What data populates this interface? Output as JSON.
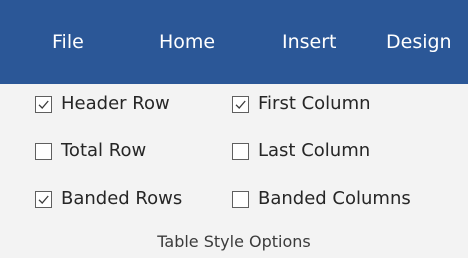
{
  "tabs": [
    "File",
    "Home",
    "Insert",
    "Design"
  ],
  "options": {
    "header_row": {
      "label": "Header Row",
      "checked": true
    },
    "total_row": {
      "label": "Total Row",
      "checked": false
    },
    "banded_rows": {
      "label": "Banded Rows",
      "checked": true
    },
    "first_column": {
      "label": "First Column",
      "checked": true
    },
    "last_column": {
      "label": "Last Column",
      "checked": false
    },
    "banded_columns": {
      "label": "Banded Columns",
      "checked": false
    }
  },
  "group_label": "Table Style Options",
  "colors": {
    "tab_bar": "#2b5797",
    "ribbon": "#f3f3f3",
    "checkbox_border": "#5f5f5f"
  }
}
